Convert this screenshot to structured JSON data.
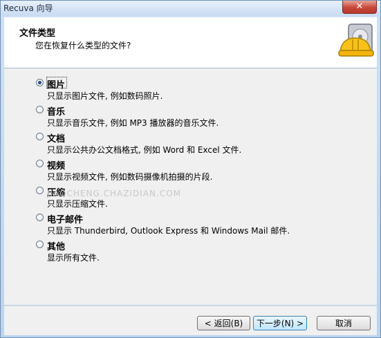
{
  "window": {
    "title": "Recuva 向导",
    "close_symbol": "✕"
  },
  "header": {
    "title": "文件类型",
    "subtitle": "您在恢复什么类型的文件?",
    "icon": "hard-drive-helmet-icon"
  },
  "options": [
    {
      "label": "图片",
      "desc": "只显示图片文件, 例如数码照片.",
      "selected": true
    },
    {
      "label": "音乐",
      "desc": "只显示音乐文件, 例如 MP3 播放器的音乐文件.",
      "selected": false
    },
    {
      "label": "文档",
      "desc": "只显示公共办公文档格式, 例如 Word 和 Excel 文件.",
      "selected": false
    },
    {
      "label": "视频",
      "desc": "只显示视频文件, 例如数码摄像机拍摄的片段.",
      "selected": false
    },
    {
      "label": "压缩",
      "desc": "只显示压缩文件.",
      "selected": false
    },
    {
      "label": "电子邮件",
      "desc": "只显示 Thunderbird, Outlook Express 和 Windows Mail 邮件.",
      "selected": false
    },
    {
      "label": "其他",
      "desc": "显示所有文件.",
      "selected": false
    }
  ],
  "watermark": "JIAOCHENG.CHAZIDIAN.COM",
  "buttons": {
    "back": "< 返回(B)",
    "next": "下一步(N) >",
    "cancel": "取消"
  }
}
